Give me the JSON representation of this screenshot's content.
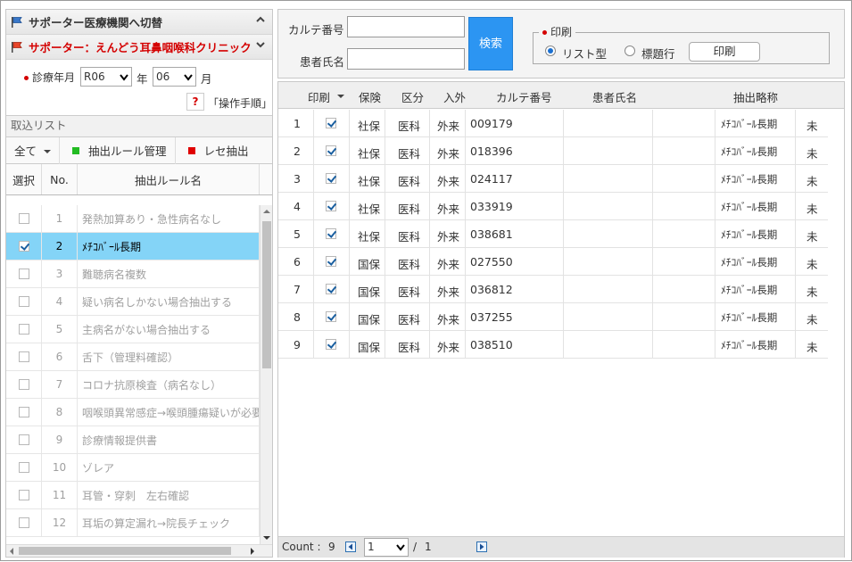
{
  "left": {
    "supporter_switch": "サポーター医療機関へ切替",
    "supporter_current": "サポーター：えんどう耳鼻咽喉科クリニック",
    "exam_label": "診療年月",
    "era_value": "R06",
    "year_suffix": "年",
    "month_value": "06",
    "month_suffix": "月",
    "help_mark": "?",
    "manual_link": "「操作手順」",
    "import_list": "取込リスト",
    "toolbar": {
      "all_label": "全て",
      "rule_manage": "抽出ルール管理",
      "rece_extract": "レセ抽出",
      "green": "#22bb22",
      "red": "#e00000"
    },
    "columns": {
      "select": "選択",
      "no": "No.",
      "rule_name": "抽出ルール名"
    },
    "rows": [
      {
        "no": "1",
        "name": "発熱加算あり・急性病名なし",
        "checked": false
      },
      {
        "no": "2",
        "name": "ﾒﾁｺﾊﾞｰﾙ長期",
        "checked": true
      },
      {
        "no": "3",
        "name": "難聴病名複数",
        "checked": false
      },
      {
        "no": "4",
        "name": "疑い病名しかない場合抽出する",
        "checked": false
      },
      {
        "no": "5",
        "name": "主病名がない場合抽出する",
        "checked": false
      },
      {
        "no": "6",
        "name": "舌下（管理料確認）",
        "checked": false
      },
      {
        "no": "7",
        "name": "コロナ抗原検査（病名なし）",
        "checked": false
      },
      {
        "no": "8",
        "name": "咽喉頭異常感症→喉頭腫瘍疑いが必要",
        "checked": false
      },
      {
        "no": "9",
        "name": "診療情報提供書",
        "checked": false
      },
      {
        "no": "10",
        "name": "ゾレア",
        "checked": false
      },
      {
        "no": "11",
        "name": "耳管・穿刺　左右確認",
        "checked": false
      },
      {
        "no": "12",
        "name": "耳垢の算定漏れ→院長チェック",
        "checked": false
      }
    ]
  },
  "search": {
    "karte_label": "カルテ番号",
    "karte_value": "",
    "patient_label": "患者氏名",
    "patient_value": "",
    "search_button": "検索",
    "print_legend": "印刷",
    "list_type": "リスト型",
    "title_type": "標題行",
    "print_button": "印刷"
  },
  "grid": {
    "headers": {
      "print": "印刷",
      "insurance": "保険",
      "category": "区分",
      "inout": "入外",
      "karte_no": "カルテ番号",
      "patient_name": "患者氏名",
      "extract_short": "抽出略称"
    },
    "rows": [
      {
        "no": "1",
        "insurance": "社保",
        "category": "医科",
        "inout": "外来",
        "karte": "009179",
        "extract": "ﾒﾁｺﾊﾞｰﾙ長期",
        "status": "未"
      },
      {
        "no": "2",
        "insurance": "社保",
        "category": "医科",
        "inout": "外来",
        "karte": "018396",
        "extract": "ﾒﾁｺﾊﾞｰﾙ長期",
        "status": "未"
      },
      {
        "no": "3",
        "insurance": "社保",
        "category": "医科",
        "inout": "外来",
        "karte": "024117",
        "extract": "ﾒﾁｺﾊﾞｰﾙ長期",
        "status": "未"
      },
      {
        "no": "4",
        "insurance": "社保",
        "category": "医科",
        "inout": "外来",
        "karte": "033919",
        "extract": "ﾒﾁｺﾊﾞｰﾙ長期",
        "status": "未"
      },
      {
        "no": "5",
        "insurance": "社保",
        "category": "医科",
        "inout": "外来",
        "karte": "038681",
        "extract": "ﾒﾁｺﾊﾞｰﾙ長期",
        "status": "未"
      },
      {
        "no": "6",
        "insurance": "国保",
        "category": "医科",
        "inout": "外来",
        "karte": "027550",
        "extract": "ﾒﾁｺﾊﾞｰﾙ長期",
        "status": "未"
      },
      {
        "no": "7",
        "insurance": "国保",
        "category": "医科",
        "inout": "外来",
        "karte": "036812",
        "extract": "ﾒﾁｺﾊﾞｰﾙ長期",
        "status": "未"
      },
      {
        "no": "8",
        "insurance": "国保",
        "category": "医科",
        "inout": "外来",
        "karte": "037255",
        "extract": "ﾒﾁｺﾊﾞｰﾙ長期",
        "status": "未"
      },
      {
        "no": "9",
        "insurance": "国保",
        "category": "医科",
        "inout": "外来",
        "karte": "038510",
        "extract": "ﾒﾁｺﾊﾞｰﾙ長期",
        "status": "未"
      }
    ],
    "footer": {
      "count_label": "Count :",
      "count_value": "9",
      "page_value": "1",
      "page_sep": "/",
      "page_total": "1"
    }
  }
}
